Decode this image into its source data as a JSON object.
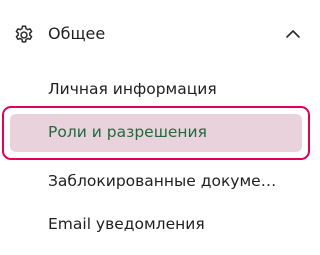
{
  "section": {
    "title": "Общее",
    "icon": "gear-icon",
    "toggle_icon": "chevron-up-icon",
    "expanded": true
  },
  "nav": {
    "items": [
      {
        "label": "Личная информация",
        "selected": false
      },
      {
        "label": "Роли и разрешения",
        "selected": true
      },
      {
        "label": "Заблокированные документы",
        "selected": false
      },
      {
        "label": "Email уведомления",
        "selected": false
      }
    ]
  },
  "colors": {
    "selected_border": "#e0005a",
    "selected_background": "#ead2dc",
    "selected_text": "#1e6b3d",
    "text": "#1f1f1f"
  }
}
